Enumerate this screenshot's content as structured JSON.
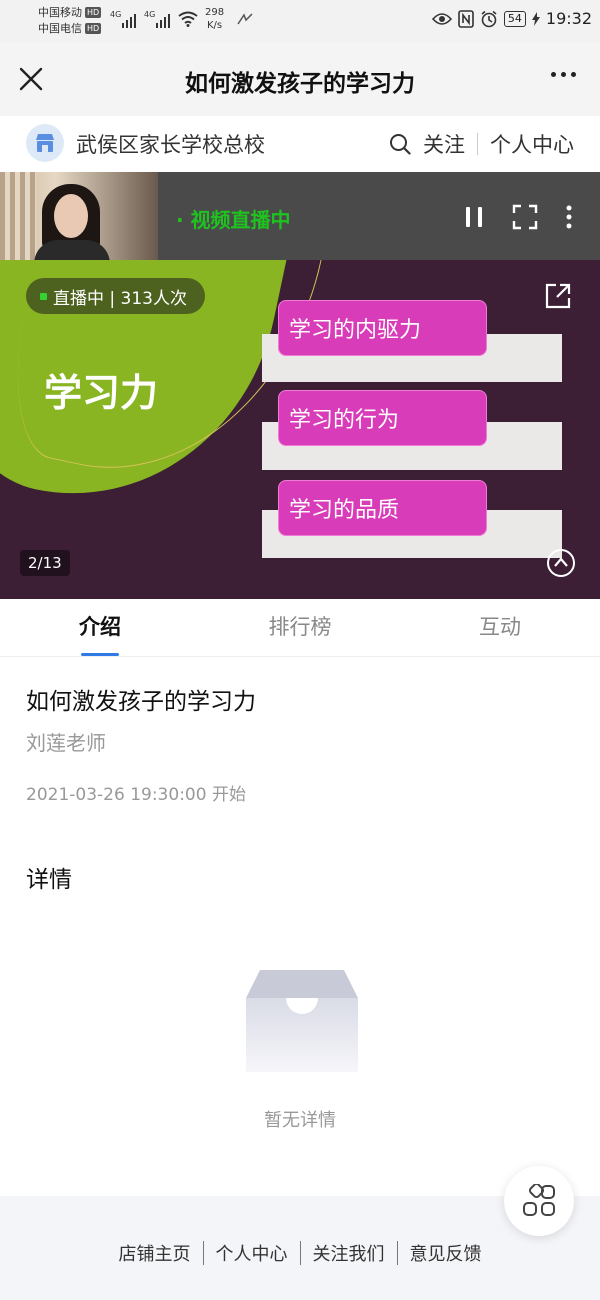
{
  "status_bar": {
    "carrier1": "中国移动",
    "carrier2": "中国电信",
    "hd": "HD",
    "net1": "4G",
    "net2": "4G",
    "speed_value": "298",
    "speed_unit": "K/s",
    "battery": "54",
    "time": "19:32"
  },
  "nav": {
    "title": "如何激发孩子的学习力"
  },
  "shop": {
    "name": "武侯区家长学校总校",
    "follow": "关注",
    "personal_center": "个人中心"
  },
  "video": {
    "live_label": "· 视频直播中",
    "viewers_text": "直播中 | 313人次",
    "slide_title": "学习力",
    "slide_items": [
      "学习的内驱力",
      "学习的行为",
      "学习的品质"
    ],
    "page_indicator": "2/13"
  },
  "tabs": [
    {
      "label": "介绍",
      "active": true
    },
    {
      "label": "排行榜",
      "active": false
    },
    {
      "label": "互动",
      "active": false
    }
  ],
  "intro": {
    "title": "如何激发孩子的学习力",
    "teacher": "刘莲老师",
    "start_time": "2021-03-26 19:30:00 开始",
    "details_heading": "详情",
    "empty_text": "暂无详情"
  },
  "footer": {
    "links": [
      "店铺主页",
      "个人中心",
      "关注我们",
      "意见反馈"
    ]
  },
  "colors": {
    "live_green": "#1fc21f",
    "slide_bg": "#3c1e35",
    "slide_green": "#88b521",
    "item_magenta": "#d93cb8",
    "tab_underline": "#2f7ae5"
  },
  "icons": [
    "close-icon",
    "more-icon",
    "shop-logo-icon",
    "search-icon",
    "pause-icon",
    "fullscreen-icon",
    "kebab-icon",
    "share-icon",
    "collapse-icon",
    "empty-box-icon",
    "grid-menu-icon"
  ]
}
